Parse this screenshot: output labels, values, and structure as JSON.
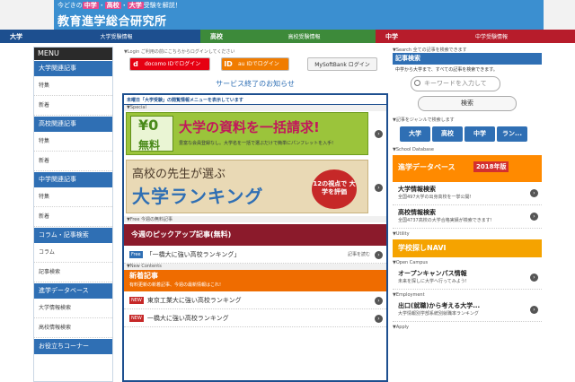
{
  "header": {
    "tagline_pre": "今どきの",
    "tagline_jh": "中学",
    "tagline_dot1": "・",
    "tagline_hs": "高校",
    "tagline_dot2": "・",
    "tagline_univ": "大学",
    "tagline_post": "受験を解説！",
    "title": "教育進学総合研究所"
  },
  "categories": [
    {
      "key": "大学",
      "sub": "大学受験情報"
    },
    {
      "key": "高校",
      "sub": "高校受験情報"
    },
    {
      "key": "中学",
      "sub": "中学受験情報"
    }
  ],
  "sidebar": {
    "menu_label": "MENU",
    "sections": [
      {
        "title": "大学関連記事",
        "items": [
          "特集",
          "新着"
        ]
      },
      {
        "title": "高校関連記事",
        "items": [
          "特集",
          "新着"
        ]
      },
      {
        "title": "中学関連記事",
        "items": [
          "特集",
          "新着"
        ]
      },
      {
        "title": "コラム・記事検索",
        "items": [
          "コラム",
          "記事検索"
        ]
      },
      {
        "title": "進学データベース",
        "items": [
          "大学情報検索",
          "高校情報検索"
        ]
      },
      {
        "title": "お役立ちコーナー",
        "items": []
      }
    ]
  },
  "login": {
    "label": "▼Login ご利用の前にこちらからログインしてください",
    "docomo_badge": "d",
    "docomo_text": "docomo IDでログイン",
    "au_badge": "ID",
    "au_text": "au IDでログイン",
    "softbank_text": "MySoftBank ログイン",
    "service_notice": "サービス終了のお知らせ"
  },
  "center": {
    "frame_title": "未曜日「大学受験」の閲覧情報メニューを表示しています",
    "special_label": "▼Special",
    "banner1": {
      "yen": "¥0",
      "muryo": "無料",
      "headline": "大学の資料を一括請求!",
      "sub": "豊富な会員登録なし。大学名を一括で選ぶだけで簡単にパンフレットを入手!"
    },
    "banner2": {
      "line1": "高校の先生が選ぶ",
      "line2": "大学ランキング",
      "circle": "12の視点で 大学を評価"
    },
    "free_label": "▼Free 今週の無料記事",
    "pickup_title": "今週のピックアップ記事(無料)",
    "pickup_item": "「一橋大に強い高校ランキング」",
    "pickup_more": "記事を読む",
    "free_tag": "Free",
    "new_label": "▼New Contents",
    "news_title": "新着記事",
    "news_sub": "有料更新の新着記事、今週の最新情報はこれ!",
    "new_tag": "NEW",
    "news_items": [
      "東京工業大に強い高校ランキング",
      "一橋大に強い高校ランキング"
    ]
  },
  "right": {
    "search_label": "▼Search 全ての記事を検索できます",
    "search_title": "記事検索",
    "search_desc": "中学から大学まで、すべての記事を検索できます。",
    "search_placeholder": "キーワードを入力して",
    "search_button": "検索",
    "genre_label": "▼記事をジャンルで検索します",
    "genres": [
      "大学",
      "高校",
      "中学",
      "ラン..."
    ],
    "db_label": "▼School Database",
    "db_title": "進学データベース",
    "db_year": "2018年版",
    "db_rows": [
      {
        "title": "大学情報検索",
        "sub": "全国497大学の出身高校を一挙公開!"
      },
      {
        "title": "高校情報検索",
        "sub": "全国4737高校の大学合格実績が検索できます!"
      }
    ],
    "utility_label": "▼Utility",
    "navi_title": "学校探しNAVI",
    "open_label": "▼Open Campus",
    "open_title": "オープンキャンパス情報",
    "open_sub": "未来を探しに大学へ行ってみよう!",
    "emp_label": "▼Employment",
    "emp_title": "出口(就職)から考える大学...",
    "emp_sub": "大学情報別学部系統別就職率ランキング",
    "apply_label": "▼Apply"
  },
  "colors": {
    "header_blue": "#3b8fd0",
    "univ_navy": "#1d4f8f",
    "hs_green": "#3d8a3a",
    "jh_red": "#b71c2b",
    "accent_orange": "#ef6c00"
  }
}
